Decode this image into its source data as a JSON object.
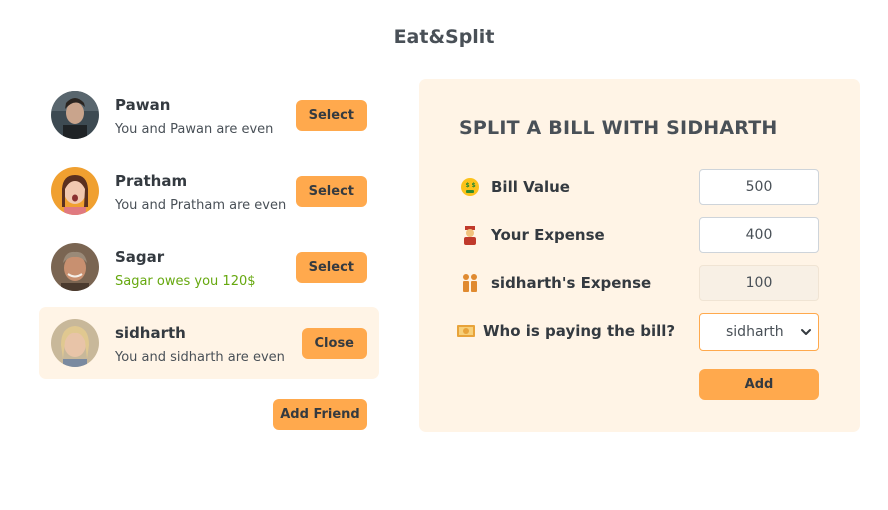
{
  "app": {
    "title": "Eat&Split"
  },
  "friends": [
    {
      "name": "Pawan",
      "status": "You and Pawan are even",
      "status_type": "even",
      "button": "Select",
      "avatar_icon": "avatar-pawan"
    },
    {
      "name": "Pratham",
      "status": "You and Pratham are even",
      "status_type": "even",
      "button": "Select",
      "avatar_icon": "avatar-pratham"
    },
    {
      "name": "Sagar",
      "status": "Sagar owes you 120$",
      "status_type": "owes-you",
      "button": "Select",
      "avatar_icon": "avatar-sagar"
    },
    {
      "name": "sidharth",
      "status": "You and sidharth are even",
      "status_type": "even",
      "button": "Close",
      "avatar_icon": "avatar-sidharth",
      "selected": true
    }
  ],
  "add_friend": {
    "label": "Add Friend"
  },
  "split_form": {
    "title": "SPLIT A BILL WITH SIDHARTH",
    "bill_value": {
      "label": "Bill Value",
      "value": "500",
      "icon": "money-face-icon"
    },
    "your_expense": {
      "label": "Your Expense",
      "value": "400",
      "icon": "person-icon"
    },
    "friend_expense": {
      "label": "sidharth's Expense",
      "value": "100",
      "icon": "people-icon"
    },
    "payer": {
      "label": "Who is paying the bill?",
      "value": "sidharth",
      "icon": "money-bills-icon"
    },
    "submit": {
      "label": "Add"
    }
  },
  "colors": {
    "accent": "#ffa94d",
    "selected_bg": "#fff4e6",
    "owes_you": "#66a80f",
    "text": "#495057"
  }
}
